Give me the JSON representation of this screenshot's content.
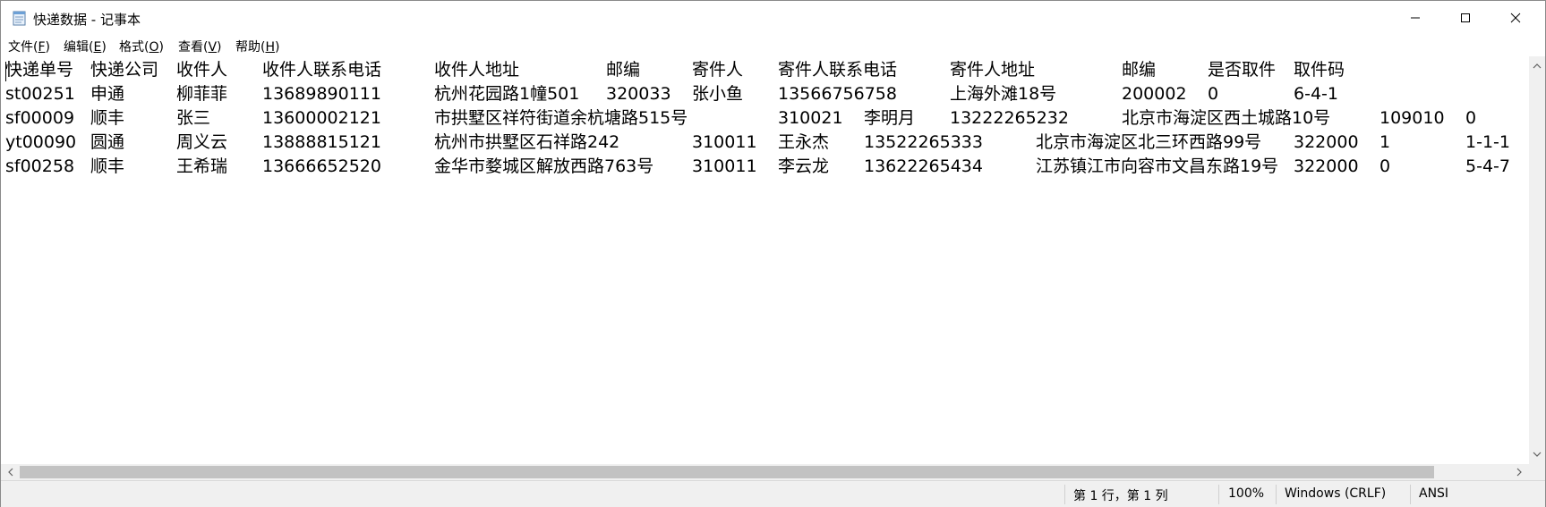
{
  "window": {
    "title": "快递数据 - 记事本",
    "icon": "notepad-icon"
  },
  "menu": {
    "file": "文件(",
    "file_acc": "F",
    "edit": "编辑(",
    "edit_acc": "E",
    "format": "格式(",
    "format_acc": "O",
    "view": "查看(",
    "view_acc": "V",
    "help": "帮助(",
    "help_acc": "H",
    "close_paren": ")"
  },
  "content": {
    "rows": [
      [
        "快递单号",
        "快递公司",
        "收件人",
        "收件人联系电话",
        "收件人地址",
        "邮编",
        "寄件人",
        "寄件人联系电话",
        "寄件人地址",
        "邮编",
        "是否取件",
        "取件码"
      ],
      [
        "st00251",
        "申通",
        "柳菲菲",
        "13689890111",
        "杭州花园路1幢501",
        "320033",
        "张小鱼",
        "13566756758",
        "上海外滩18号",
        "200002",
        "0",
        "6-4-1"
      ],
      [
        "sf00009",
        "顺丰",
        "张三",
        "13600002121",
        "市拱墅区祥符街道余杭塘路515号",
        "310021",
        "李明月",
        "13222265232",
        "北京市海淀区西土城路10号",
        "109010",
        "0"
      ],
      [
        "yt00090",
        "圆通",
        "周义云",
        "13888815121",
        "杭州市拱墅区石祥路242",
        "310011",
        "王永杰",
        "13522265333",
        "北京市海淀区北三环西路99号",
        "322000",
        "1",
        "1-1-1"
      ],
      [
        "sf00258",
        "顺丰",
        "王希瑞",
        "13666652520",
        "金华市婺城区解放西路763号",
        "310011",
        "李云龙",
        "13622265434",
        "江苏镇江市向容市文昌东路19号",
        "322000",
        "0",
        "5-4-7"
      ]
    ]
  },
  "status": {
    "position": "第 1 行，第 1 列",
    "zoom": "100%",
    "line_ending": "Windows (CRLF)",
    "encoding": "ANSI"
  }
}
